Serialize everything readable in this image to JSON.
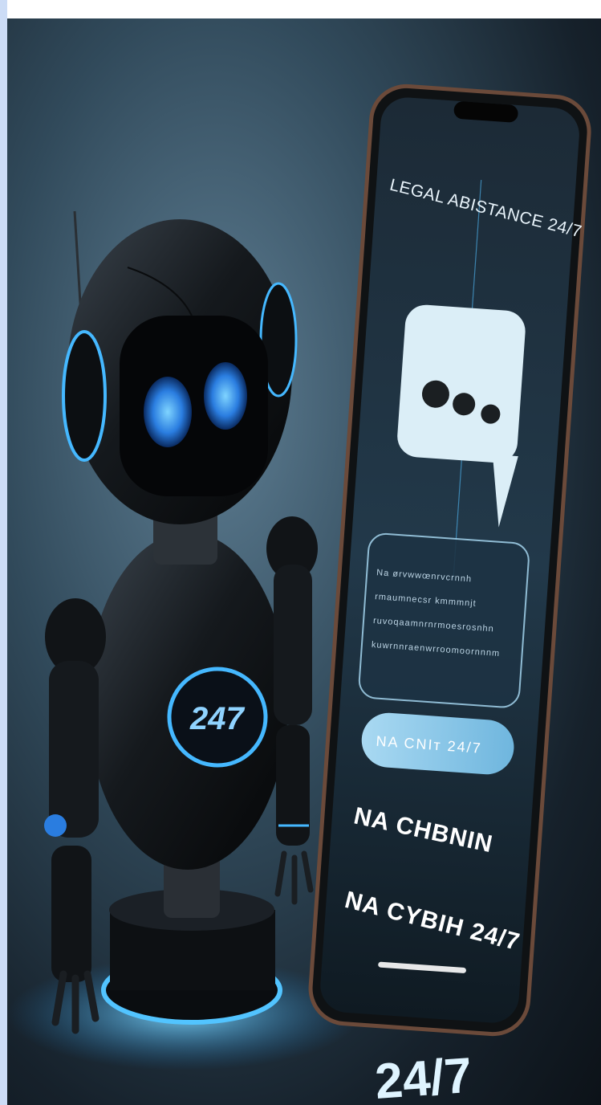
{
  "image": {
    "subject": "robot-beside-smartphone",
    "colors": {
      "glow": "#39b4ff",
      "robot_body": "#15191d",
      "phone_frame": "#0f1214",
      "bubble": "#dbeef7"
    }
  },
  "phone": {
    "title": "LEGAL ABISTANCE 24/7",
    "card_lines": [
      "Na ørvwwœnrvcrnnh",
      "rmaumnecsr kmmmnjt",
      "ruvoqaamnrnrmoesrosnhn",
      "kuwrnnraenwrroomoornnnm"
    ],
    "pill_text": "NA CNIᴛ 24/7",
    "line1": "NA CHBNIN",
    "line2": "NA CYBIH 24/7"
  },
  "robot": {
    "chest_text": "247"
  },
  "floor_text": "24/7"
}
